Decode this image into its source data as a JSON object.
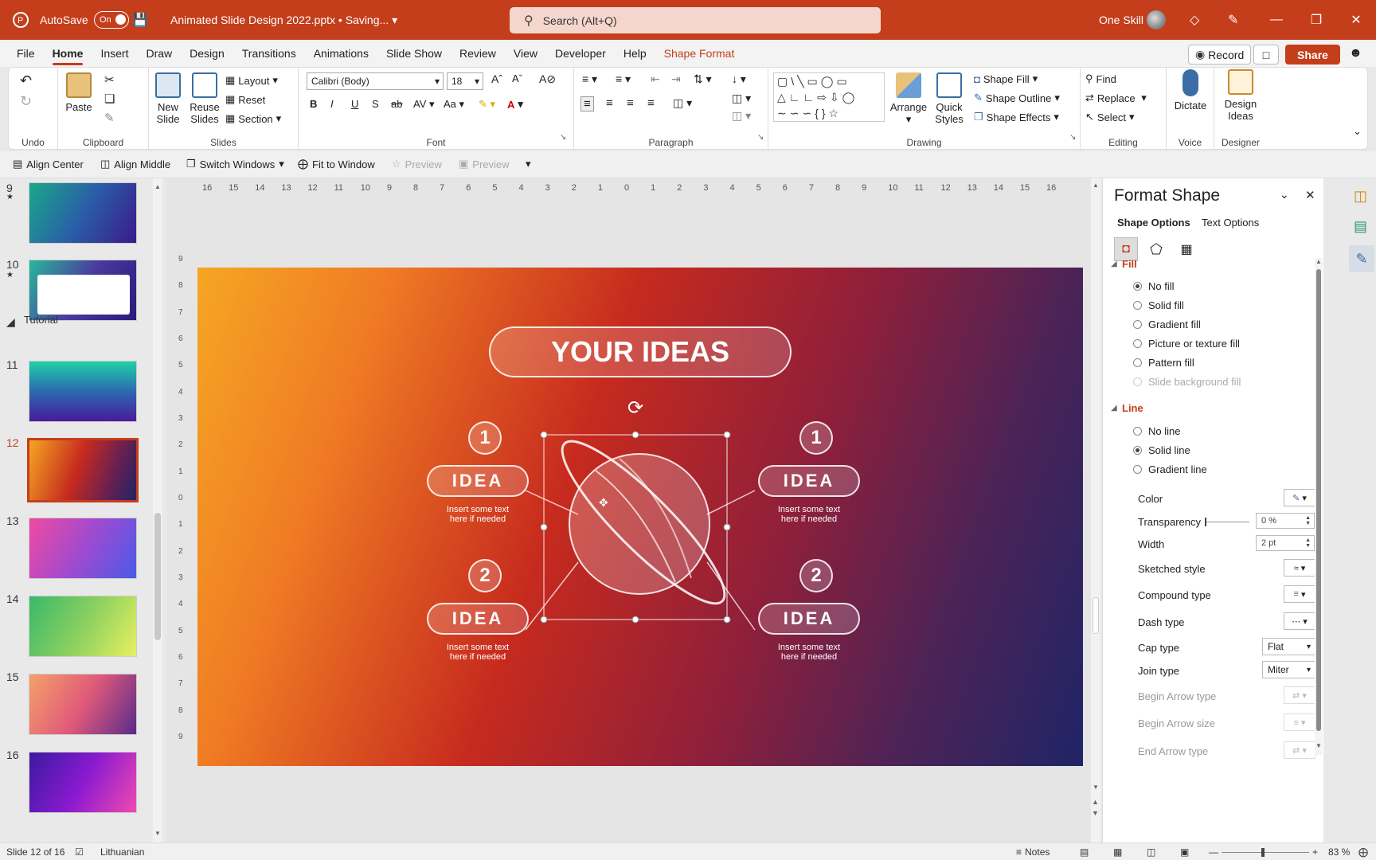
{
  "app": {
    "autosave_label": "AutoSave",
    "autosave_state": "On",
    "file_title": "Animated Slide Design 2022.pptx • Saving...",
    "search_placeholder": "Search (Alt+Q)",
    "user_name": "One Skill"
  },
  "tabs": [
    "File",
    "Home",
    "Insert",
    "Draw",
    "Design",
    "Transitions",
    "Animations",
    "Slide Show",
    "Review",
    "View",
    "Developer",
    "Help",
    "Shape Format"
  ],
  "header_buttons": {
    "record": "Record",
    "share": "Share"
  },
  "ribbon": {
    "undo_group": "Undo",
    "clipboard": {
      "paste": "Paste",
      "group": "Clipboard"
    },
    "slides": {
      "new_slide": "New Slide",
      "reuse_slides": "Reuse Slides",
      "layout": "Layout",
      "reset": "Reset",
      "section": "Section",
      "group": "Slides"
    },
    "font": {
      "name": "Calibri (Body)",
      "size": "18",
      "group": "Font"
    },
    "paragraph": {
      "group": "Paragraph"
    },
    "drawing": {
      "arrange": "Arrange",
      "quick_styles": "Quick Styles",
      "shape_fill": "Shape Fill",
      "shape_outline": "Shape Outline",
      "shape_effects": "Shape Effects",
      "group": "Drawing"
    },
    "editing": {
      "find": "Find",
      "replace": "Replace",
      "select": "Select",
      "group": "Editing"
    },
    "voice": {
      "dictate": "Dictate",
      "group": "Voice"
    },
    "designer": {
      "design_ideas": "Design Ideas",
      "group": "Designer"
    }
  },
  "qat": {
    "align_center": "Align Center",
    "align_middle": "Align Middle",
    "switch_windows": "Switch Windows",
    "fit_to_window": "Fit to Window",
    "preview1": "Preview",
    "preview2": "Preview"
  },
  "thumbnails": {
    "section_name": "Tutorial",
    "items": [
      {
        "num": "9",
        "starred": true
      },
      {
        "num": "10",
        "starred": true
      },
      {
        "num": "11",
        "starred": false
      },
      {
        "num": "12",
        "starred": false,
        "selected": true
      },
      {
        "num": "13",
        "starred": false
      },
      {
        "num": "14",
        "starred": false
      },
      {
        "num": "15",
        "starred": false
      },
      {
        "num": "16",
        "starred": false
      }
    ],
    "star": "★"
  },
  "ruler": {
    "h_ticks": [
      "16",
      "15",
      "14",
      "13",
      "12",
      "11",
      "10",
      "9",
      "8",
      "7",
      "6",
      "5",
      "4",
      "3",
      "2",
      "1",
      "0",
      "1",
      "2",
      "3",
      "4",
      "5",
      "6",
      "7",
      "8",
      "9",
      "10",
      "11",
      "12",
      "13",
      "14",
      "15",
      "16"
    ],
    "v_ticks": [
      "9",
      "8",
      "7",
      "6",
      "5",
      "4",
      "3",
      "2",
      "1",
      "0",
      "1",
      "2",
      "3",
      "4",
      "5",
      "6",
      "7",
      "8",
      "9"
    ]
  },
  "slide": {
    "title": "YOUR IDEAS",
    "nodes": [
      {
        "num": "1",
        "label": "IDEA",
        "text1": "Insert some text",
        "text2": "here if needed"
      },
      {
        "num": "2",
        "label": "IDEA",
        "text1": "Insert some text",
        "text2": "here if needed"
      },
      {
        "num": "1",
        "label": "IDEA",
        "text1": "Insert some text",
        "text2": "here if needed"
      },
      {
        "num": "2",
        "label": "IDEA",
        "text1": "Insert some text",
        "text2": "here if needed"
      }
    ]
  },
  "format_pane": {
    "title": "Format Shape",
    "tab_shape": "Shape Options",
    "tab_text": "Text Options",
    "fill_section": "Fill",
    "fill_options": [
      "No fill",
      "Solid fill",
      "Gradient fill",
      "Picture or texture fill",
      "Pattern fill",
      "Slide background fill"
    ],
    "line_section": "Line",
    "line_options": [
      "No line",
      "Solid line",
      "Gradient line"
    ],
    "props": {
      "color": "Color",
      "transparency": "Transparency",
      "transparency_value": "0 %",
      "width": "Width",
      "width_value": "2 pt",
      "sketched": "Sketched style",
      "compound": "Compound type",
      "dash": "Dash type",
      "cap": "Cap type",
      "cap_value": "Flat",
      "join": "Join type",
      "join_value": "Miter",
      "begin_arrow_type": "Begin Arrow type",
      "begin_arrow_size": "Begin Arrow size",
      "end_arrow_type": "End Arrow type"
    }
  },
  "status": {
    "slide_info": "Slide 12 of 16",
    "language": "Lithuanian",
    "notes": "Notes",
    "zoom": "83 %"
  },
  "colors": {
    "accent": "#c43e1c"
  }
}
